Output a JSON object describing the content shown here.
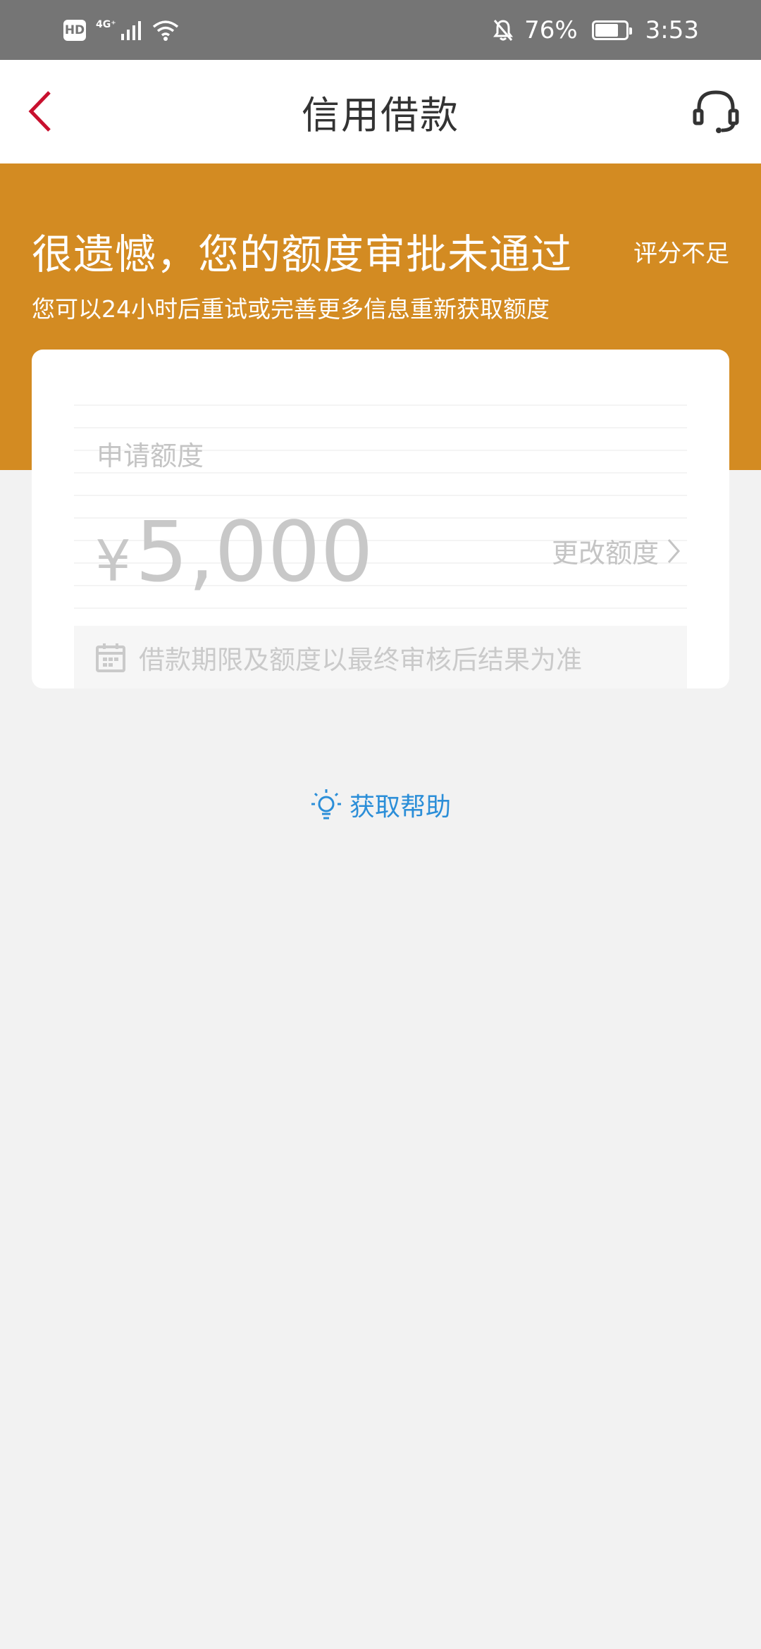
{
  "status_bar": {
    "hd": "HD",
    "network": "4G⁺",
    "battery": "76%",
    "battery_level": 0.76,
    "time": "3:53"
  },
  "header": {
    "title": "信用借款",
    "back_icon": "chevron-left-icon",
    "support_icon": "headset-icon",
    "accent_color": "#c8102e"
  },
  "banner": {
    "title": "很遗憾，您的额度审批未通过",
    "tag": "评分不足",
    "subtitle": "您可以24小时后重试或完善更多信息重新获取额度",
    "color": "#d38b22"
  },
  "card": {
    "amount_label": "申请额度",
    "currency": "¥",
    "amount": "5,000",
    "change_label": "更改额度",
    "notice": "借款期限及额度以最终审核后结果为准",
    "notice_icon": "calendar-icon"
  },
  "help": {
    "label": "获取帮助",
    "icon": "lightbulb-icon",
    "color": "#2b8ed8"
  }
}
